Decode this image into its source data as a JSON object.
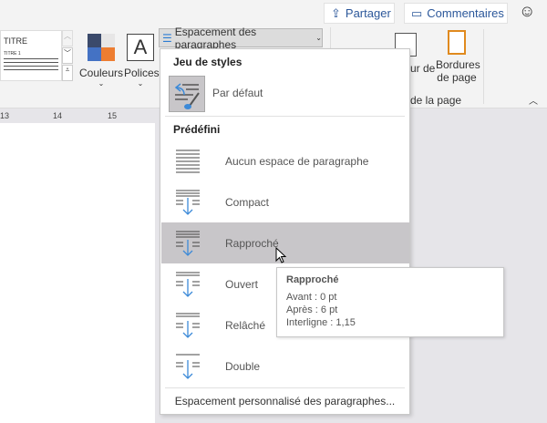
{
  "topbar": {
    "share": "Partager",
    "comments": "Commentaires",
    "icons": [
      "share-icon",
      "comment-icon",
      "smiley-icon"
    ]
  },
  "ribbon": {
    "styles_gallery": {
      "title": "TITRE",
      "subtitle": "TITRE 1"
    },
    "colors": "Couleurs",
    "fonts": "Polices",
    "fonts_glyph": "A",
    "spacing_button": "Espacement des paragraphes",
    "page_color_partial": "ur de",
    "page_borders_line1": "Bordures",
    "page_borders_line2": "de page",
    "group_label_partial": "de la page"
  },
  "ruler": {
    "ticks": [
      "13",
      "14",
      "15"
    ]
  },
  "menu": {
    "style_set_header": "Jeu de styles",
    "default_item": "Par défaut",
    "predefined_header": "Prédéfini",
    "items": [
      {
        "label": "Aucun espace de paragraphe"
      },
      {
        "label": "Compact"
      },
      {
        "label": "Rapproché",
        "hovered": true
      },
      {
        "label": "Ouvert"
      },
      {
        "label": "Relâché"
      },
      {
        "label": "Double"
      }
    ],
    "custom": "Espacement personnalisé des paragraphes..."
  },
  "tooltip": {
    "title": "Rapproché",
    "before": "Avant : 0 pt",
    "after": "Après : 6 pt",
    "line": "Interligne : 1,15"
  },
  "colors": {
    "accent": "#2b579a",
    "hover": "#c8c6c9",
    "arrow": "#3c8ad8"
  }
}
